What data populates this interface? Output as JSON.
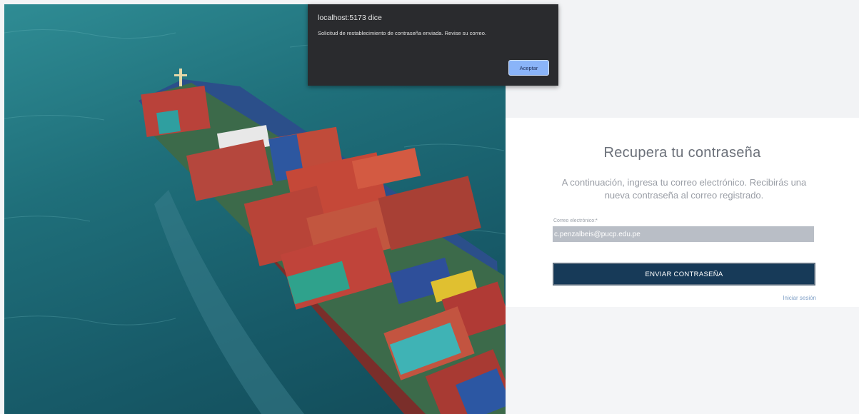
{
  "dialog": {
    "title": "localhost:5173 dice",
    "message": "Solicitud de restablecimiento de contraseña enviada. Revise su correo.",
    "accept_label": "Aceptar"
  },
  "form": {
    "title": "Recupera tu contraseña",
    "subtitle": "A continuación, ingresa tu correo electrónico. Recibirás una nueva contraseña al correo registrado.",
    "email_label": "Correo electrónico:*",
    "email_value": "c.penzalbeis@pucp.edu.pe",
    "submit_label": "ENVIAR CONTRASEÑA",
    "login_link": "Iniciar sesión"
  },
  "colors": {
    "button_bg": "#173a58",
    "dialog_bg": "#2a2b2e",
    "dialog_button": "#8ab4f8"
  }
}
